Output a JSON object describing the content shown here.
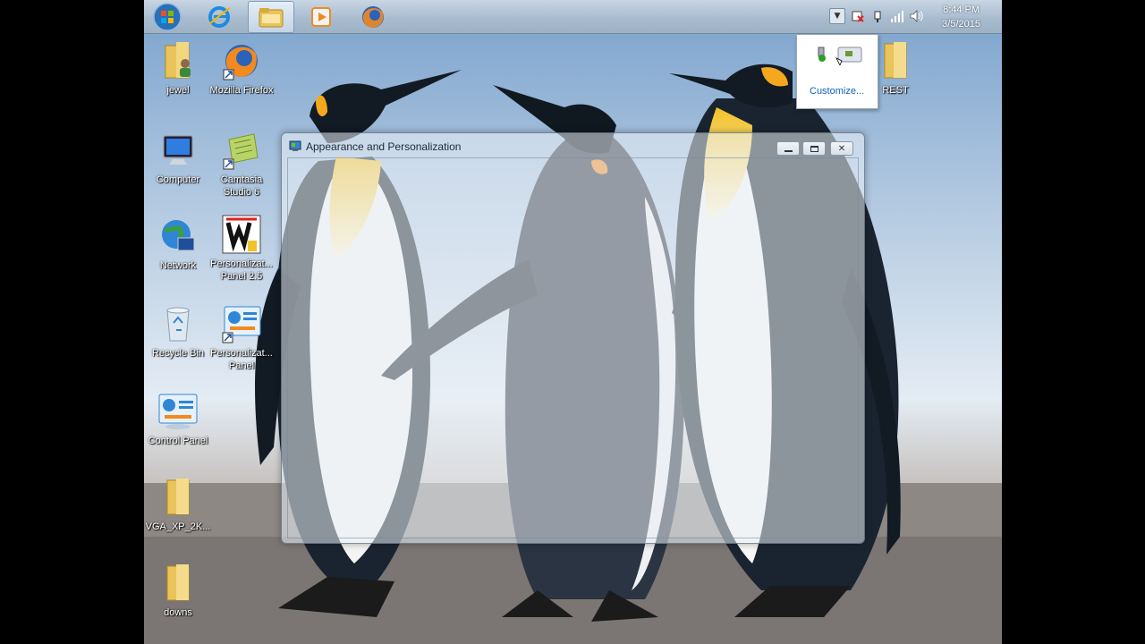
{
  "taskbar": {
    "start_button": "start-orb",
    "pinned": [
      {
        "name": "internet-explorer",
        "icon": "ie-icon"
      },
      {
        "name": "windows-explorer",
        "icon": "folder-icon",
        "active": true
      },
      {
        "name": "media-player",
        "icon": "media-player-icon"
      },
      {
        "name": "firefox",
        "icon": "firefox-icon"
      }
    ],
    "clock": {
      "time": "8:44 PM",
      "date": "3/5/2015"
    }
  },
  "tray_popup": {
    "customize_label": "Customize..."
  },
  "desktop_icons": [
    {
      "label": "jewel",
      "icon": "user-folder-icon"
    },
    {
      "label": "Mozilla Firefox",
      "icon": "firefox-icon"
    },
    {
      "label": "Computer",
      "icon": "computer-icon"
    },
    {
      "label": "Camtasia Studio 6",
      "icon": "camtasia-icon"
    },
    {
      "label": "Network",
      "icon": "network-icon"
    },
    {
      "label": "Personalizat... Panel 2.5",
      "icon": "personalization-panel-w-icon"
    },
    {
      "label": "Recycle Bin",
      "icon": "recycle-bin-icon"
    },
    {
      "label": "Personalizat... Panel",
      "icon": "personalization-panel-icon"
    },
    {
      "label": "Control Panel",
      "icon": "control-panel-icon"
    },
    {
      "label": "VGA_XP_2K...",
      "icon": "folder-icon"
    },
    {
      "label": "downs",
      "icon": "folder-icon"
    },
    {
      "label": "REST",
      "icon": "folder-icon"
    }
  ],
  "window": {
    "title": "Appearance and Personalization",
    "controls": [
      "minimize",
      "maximize",
      "close"
    ]
  },
  "colors": {
    "taskbar": "#a9bccf",
    "link": "#0f62b8",
    "sky": "#a8c3df",
    "sand": "#8e8a86"
  }
}
